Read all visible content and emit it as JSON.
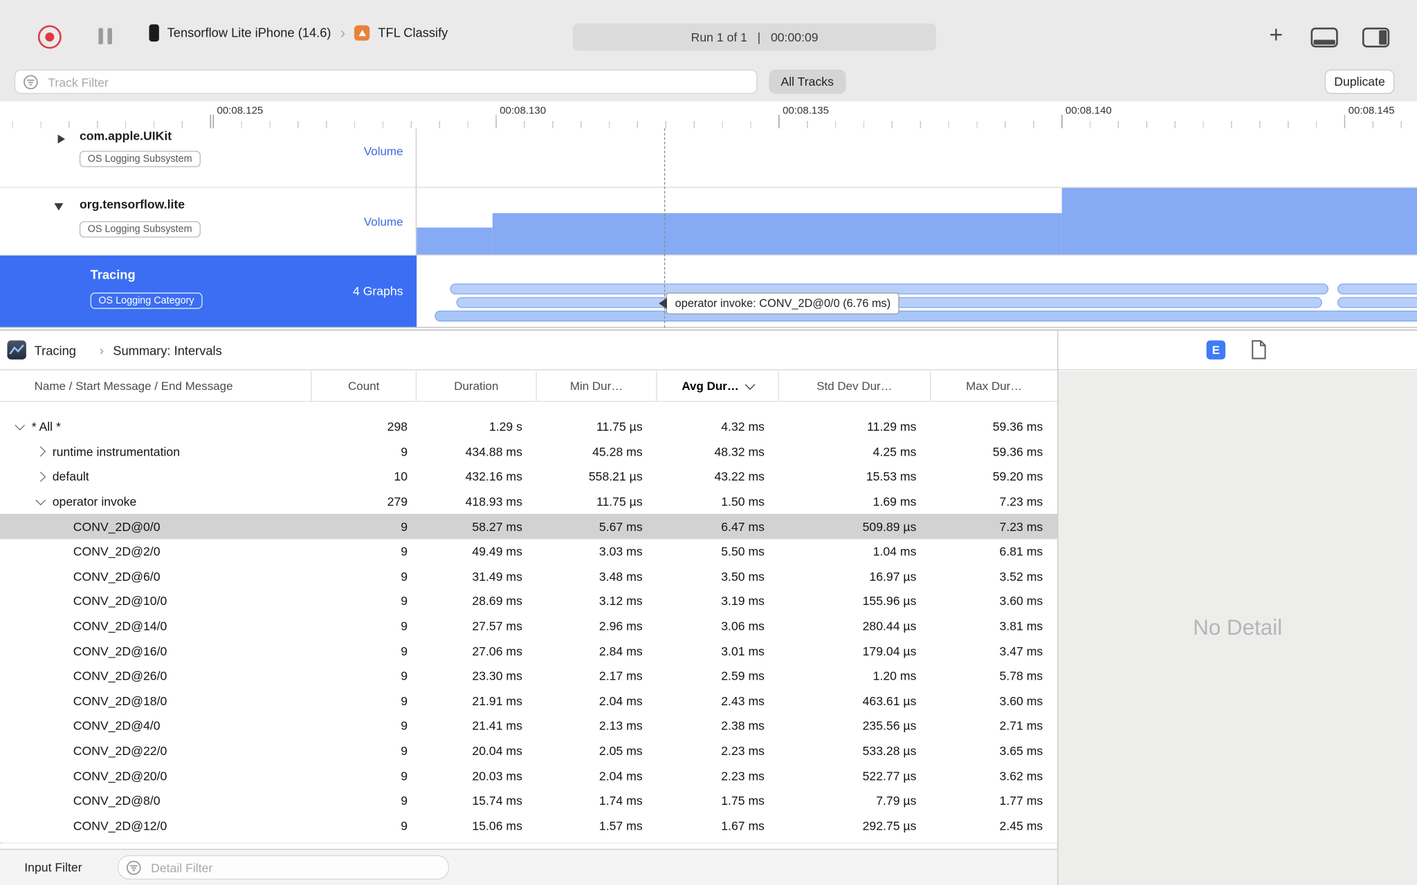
{
  "toolbar": {
    "device": "Tensorflow Lite iPhone (14.6)",
    "target": "TFL Classify",
    "run_status": "Run 1 of 1   |   00:00:09",
    "plus_label": "+"
  },
  "filter_bar": {
    "track_filter_placeholder": "Track Filter",
    "all_tracks_label": "All Tracks",
    "duplicate_label": "Duplicate"
  },
  "ruler": {
    "labels": [
      "00:08.125",
      "00:08.130",
      "00:08.135",
      "00:08.140",
      "00:08.145"
    ]
  },
  "tracks": [
    {
      "name": "com.apple.UIKit",
      "badge": "OS Logging Subsystem",
      "meta": "Volume",
      "disclosure": "closed"
    },
    {
      "name": "org.tensorflow.lite",
      "badge": "OS Logging Subsystem",
      "meta": "Volume",
      "disclosure": "open"
    },
    {
      "name": "Tracing",
      "badge": "OS Logging Category",
      "meta": "4 Graphs",
      "disclosure": "none",
      "selected": true
    }
  ],
  "timeline": {
    "tooltip": "operator invoke: CONV_2D@0/0 (6.76 ms)"
  },
  "pane": {
    "breadcrumb_root": "Tracing",
    "breadcrumb_sep": "›",
    "breadcrumb_page": "Summary: Intervals",
    "e_button_label": "E"
  },
  "table": {
    "columns": [
      "Name / Start Message / End Message",
      "Count",
      "Duration",
      "Min Dur…",
      "Avg Dur…",
      "Std Dev Dur…",
      "Max Dur…"
    ],
    "rows": [
      {
        "name": "* All *",
        "count": "298",
        "duration": "1.29 s",
        "min": "11.75 µs",
        "avg": "4.32 ms",
        "std": "11.29 ms",
        "max": "59.36 ms",
        "level": 0,
        "disc": "open",
        "selected": false
      },
      {
        "name": "runtime instrumentation",
        "count": "9",
        "duration": "434.88 ms",
        "min": "45.28 ms",
        "avg": "48.32 ms",
        "std": "4.25 ms",
        "max": "59.36 ms",
        "level": 1,
        "disc": "closed",
        "selected": false
      },
      {
        "name": "default",
        "count": "10",
        "duration": "432.16 ms",
        "min": "558.21 µs",
        "avg": "43.22 ms",
        "std": "15.53 ms",
        "max": "59.20 ms",
        "level": 1,
        "disc": "closed",
        "selected": false
      },
      {
        "name": "operator invoke",
        "count": "279",
        "duration": "418.93 ms",
        "min": "11.75 µs",
        "avg": "1.50 ms",
        "std": "1.69 ms",
        "max": "7.23 ms",
        "level": 1,
        "disc": "open",
        "selected": false
      },
      {
        "name": "CONV_2D@0/0",
        "count": "9",
        "duration": "58.27 ms",
        "min": "5.67 ms",
        "avg": "6.47 ms",
        "std": "509.89 µs",
        "max": "7.23 ms",
        "level": 2,
        "disc": "none",
        "selected": true
      },
      {
        "name": "CONV_2D@2/0",
        "count": "9",
        "duration": "49.49 ms",
        "min": "3.03 ms",
        "avg": "5.50 ms",
        "std": "1.04 ms",
        "max": "6.81 ms",
        "level": 2,
        "disc": "none",
        "selected": false
      },
      {
        "name": "CONV_2D@6/0",
        "count": "9",
        "duration": "31.49 ms",
        "min": "3.48 ms",
        "avg": "3.50 ms",
        "std": "16.97 µs",
        "max": "3.52 ms",
        "level": 2,
        "disc": "none",
        "selected": false
      },
      {
        "name": "CONV_2D@10/0",
        "count": "9",
        "duration": "28.69 ms",
        "min": "3.12 ms",
        "avg": "3.19 ms",
        "std": "155.96 µs",
        "max": "3.60 ms",
        "level": 2,
        "disc": "none",
        "selected": false
      },
      {
        "name": "CONV_2D@14/0",
        "count": "9",
        "duration": "27.57 ms",
        "min": "2.96 ms",
        "avg": "3.06 ms",
        "std": "280.44 µs",
        "max": "3.81 ms",
        "level": 2,
        "disc": "none",
        "selected": false
      },
      {
        "name": "CONV_2D@16/0",
        "count": "9",
        "duration": "27.06 ms",
        "min": "2.84 ms",
        "avg": "3.01 ms",
        "std": "179.04 µs",
        "max": "3.47 ms",
        "level": 2,
        "disc": "none",
        "selected": false
      },
      {
        "name": "CONV_2D@26/0",
        "count": "9",
        "duration": "23.30 ms",
        "min": "2.17 ms",
        "avg": "2.59 ms",
        "std": "1.20 ms",
        "max": "5.78 ms",
        "level": 2,
        "disc": "none",
        "selected": false
      },
      {
        "name": "CONV_2D@18/0",
        "count": "9",
        "duration": "21.91 ms",
        "min": "2.04 ms",
        "avg": "2.43 ms",
        "std": "463.61 µs",
        "max": "3.60 ms",
        "level": 2,
        "disc": "none",
        "selected": false
      },
      {
        "name": "CONV_2D@4/0",
        "count": "9",
        "duration": "21.41 ms",
        "min": "2.13 ms",
        "avg": "2.38 ms",
        "std": "235.56 µs",
        "max": "2.71 ms",
        "level": 2,
        "disc": "none",
        "selected": false
      },
      {
        "name": "CONV_2D@22/0",
        "count": "9",
        "duration": "20.04 ms",
        "min": "2.05 ms",
        "avg": "2.23 ms",
        "std": "533.28 µs",
        "max": "3.65 ms",
        "level": 2,
        "disc": "none",
        "selected": false
      },
      {
        "name": "CONV_2D@20/0",
        "count": "9",
        "duration": "20.03 ms",
        "min": "2.04 ms",
        "avg": "2.23 ms",
        "std": "522.77 µs",
        "max": "3.62 ms",
        "level": 2,
        "disc": "none",
        "selected": false
      },
      {
        "name": "CONV_2D@8/0",
        "count": "9",
        "duration": "15.74 ms",
        "min": "1.74 ms",
        "avg": "1.75 ms",
        "std": "7.79 µs",
        "max": "1.77 ms",
        "level": 2,
        "disc": "none",
        "selected": false
      },
      {
        "name": "CONV_2D@12/0",
        "count": "9",
        "duration": "15.06 ms",
        "min": "1.57 ms",
        "avg": "1.67 ms",
        "std": "292.75 µs",
        "max": "2.45 ms",
        "level": 2,
        "disc": "none",
        "selected": false
      }
    ]
  },
  "detail": {
    "empty_text": "No Detail"
  },
  "bottom": {
    "input_filter_label": "Input Filter",
    "detail_filter_placeholder": "Detail Filter"
  },
  "colors": {
    "selection_blue": "#3b6ef3",
    "track_fill_blue": "#86aaf4",
    "interval_fill_blue": "#b7cff9",
    "record_red": "#dd3b40",
    "app_icon_orange": "#e8823a",
    "selected_row_gray": "#d3d2d2"
  }
}
